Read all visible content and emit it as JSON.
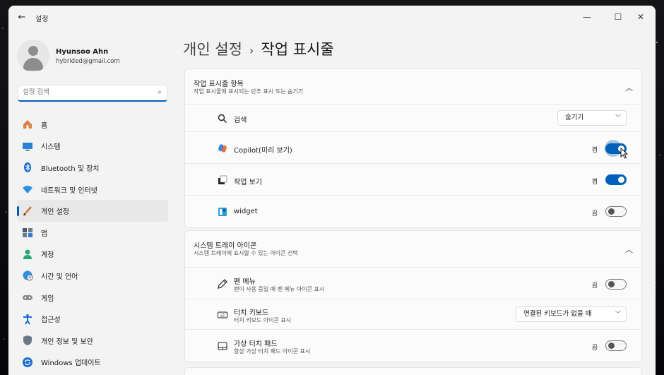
{
  "window": {
    "title": "설정",
    "back_icon": "arrow-left-icon",
    "controls": [
      "minimize-icon",
      "maximize-icon",
      "close-icon"
    ]
  },
  "profile": {
    "name": "Hyunsoo Ahn",
    "email": "hybrided@gmail.com"
  },
  "search": {
    "placeholder": "설정 검색"
  },
  "nav": {
    "items": [
      {
        "label": "홈",
        "icon": "home-icon",
        "active": false
      },
      {
        "label": "시스템",
        "icon": "monitor-icon",
        "active": false
      },
      {
        "label": "Bluetooth 및 장치",
        "icon": "bluetooth-icon",
        "active": false
      },
      {
        "label": "네트워크 및 인터넷",
        "icon": "wifi-icon",
        "active": false
      },
      {
        "label": "개인 설정",
        "icon": "paintbrush-icon",
        "active": true
      },
      {
        "label": "앱",
        "icon": "apps-icon",
        "active": false
      },
      {
        "label": "계정",
        "icon": "person-icon",
        "active": false
      },
      {
        "label": "시간 및 언어",
        "icon": "globe-clock-icon",
        "active": false
      },
      {
        "label": "게임",
        "icon": "gamepad-icon",
        "active": false
      },
      {
        "label": "접근성",
        "icon": "accessibility-icon",
        "active": false
      },
      {
        "label": "개인 정보 및 보안",
        "icon": "shield-icon",
        "active": false
      },
      {
        "label": "Windows 업데이트",
        "icon": "update-icon",
        "active": false
      }
    ]
  },
  "breadcrumb": {
    "parent": "개인 설정",
    "separator": "›",
    "current": "작업 표시줄"
  },
  "taskbar_items": {
    "title": "작업 표시줄 항목",
    "subtitle": "작업 표시줄에 표시되는 단추 표시 또는 숨기기",
    "rows": [
      {
        "label": "검색",
        "icon": "search-icon",
        "control": "select",
        "value": "숨기기"
      },
      {
        "label": "Copilot(미리 보기)",
        "icon": "copilot-icon",
        "control": "toggle",
        "state": "켬",
        "on": true
      },
      {
        "label": "작업 보기",
        "icon": "task-view-icon",
        "control": "toggle",
        "state": "켬",
        "on": true
      },
      {
        "label": "widget",
        "icon": "widget-icon",
        "control": "toggle",
        "state": "끔",
        "on": false
      }
    ]
  },
  "system_tray": {
    "title": "시스템 트레이 아이콘",
    "subtitle": "시스템 트레이에 표시할 수 있는 아이콘 선택",
    "rows": [
      {
        "label": "펜 메뉴",
        "sub": "펜이 사용 중일 때 펜 메뉴 아이콘 표시",
        "icon": "pen-icon",
        "control": "toggle",
        "state": "끔",
        "on": false
      },
      {
        "label": "터치 키보드",
        "sub": "터치 키보드 아이콘 표시",
        "icon": "keyboard-icon",
        "control": "select",
        "value": "연결된 키보드가 없을 때"
      },
      {
        "label": "가상 터치 패드",
        "sub": "항상 가상 터치 패드 아이콘 표시",
        "icon": "touchpad-icon",
        "control": "toggle",
        "state": "끔",
        "on": false
      }
    ]
  },
  "colors": {
    "accent": "#005fb8",
    "window_bg": "#f3f3f3",
    "card_bg": "#fbfbfb"
  }
}
